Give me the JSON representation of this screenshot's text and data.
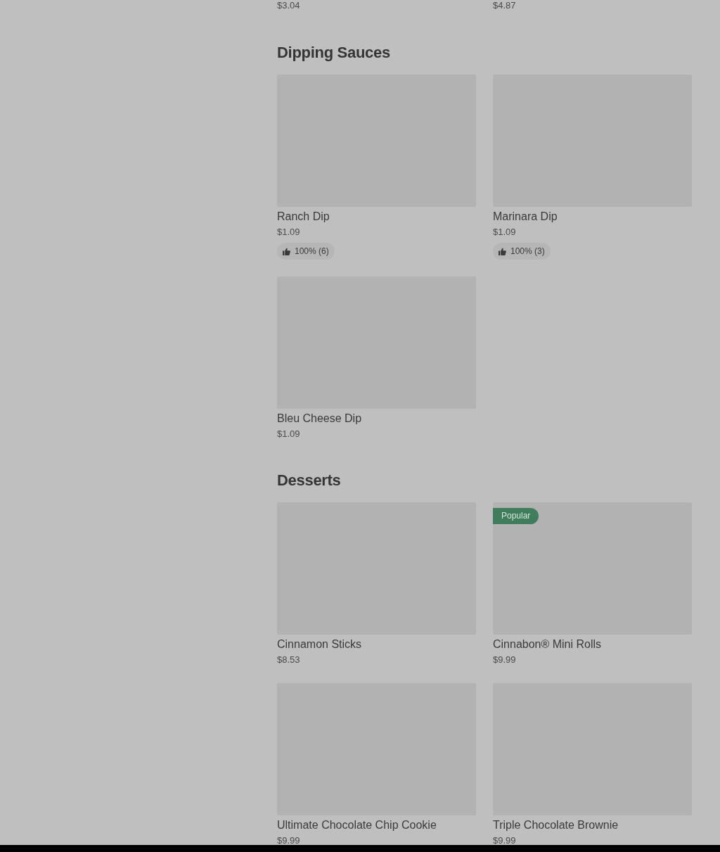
{
  "previous_section_items": [
    {
      "price": "$3.04"
    },
    {
      "price": "$4.87"
    }
  ],
  "sections": [
    {
      "title": "Dipping Sauces",
      "rows": [
        [
          {
            "name": "Ranch Dip",
            "price": "$1.09",
            "rating": "100% (6)"
          },
          {
            "name": "Marinara Dip",
            "price": "$1.09",
            "rating": "100% (3)"
          }
        ],
        [
          {
            "name": "Bleu Cheese Dip",
            "price": "$1.09"
          }
        ]
      ]
    },
    {
      "title": "Desserts",
      "rows": [
        [
          {
            "name": "Cinnamon Sticks",
            "price": "$8.53"
          },
          {
            "tag": "Popular",
            "name": "Cinnabon® Mini Rolls",
            "price": "$9.99"
          }
        ],
        [
          {
            "name": "Ultimate Chocolate Chip Cookie",
            "price": "$9.99"
          },
          {
            "name": "Triple Chocolate Brownie",
            "price": "$9.99"
          }
        ]
      ]
    }
  ]
}
